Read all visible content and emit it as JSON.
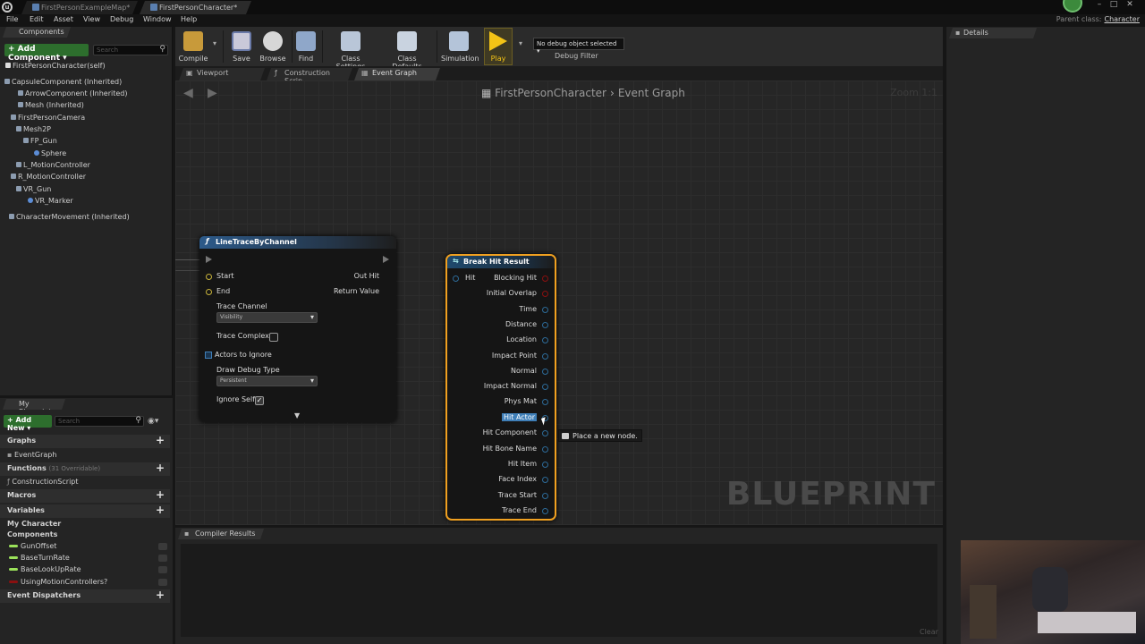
{
  "window": {
    "tabs": [
      "FirstPersonExampleMap*",
      "FirstPersonCharacter*"
    ],
    "parent_class_label": "Parent class:",
    "parent_class_value": "Character"
  },
  "menubar": [
    "File",
    "Edit",
    "Asset",
    "View",
    "Debug",
    "Window",
    "Help"
  ],
  "components": {
    "tab": "Components",
    "add_button": "+ Add Component ▾",
    "search_placeholder": "Search",
    "self": "FirstPersonCharacter(self)",
    "tree": [
      "CapsuleComponent (Inherited)",
      "ArrowComponent (Inherited)",
      "Mesh (Inherited)",
      "FirstPersonCamera",
      "Mesh2P",
      "FP_Gun",
      "Sphere",
      "L_MotionController",
      "R_MotionController",
      "VR_Gun",
      "VR_Marker",
      "CharacterMovement (Inherited)"
    ]
  },
  "my_blueprint": {
    "tab": "My Blueprint",
    "add_button": "+ Add New ▾",
    "search_placeholder": "Search",
    "graphs_label": "Graphs",
    "event_graph": "EventGraph",
    "functions_label": "Functions",
    "functions_count": "(31 Overridable)",
    "construction_script": "ConstructionScript",
    "macros_label": "Macros",
    "variables_label": "Variables",
    "my_character": "My Character",
    "components_label": "Components",
    "variables": [
      "GunOffset",
      "BaseTurnRate",
      "BaseLookUpRate",
      "UsingMotionControllers?"
    ],
    "event_dispatchers": "Event Dispatchers"
  },
  "toolbar": {
    "buttons": [
      "Compile",
      "Save",
      "Browse",
      "Find",
      "Class Settings",
      "Class Defaults",
      "Simulation",
      "Play"
    ],
    "debug_select": "No debug object selected ▾",
    "debug_filter": "Debug Filter"
  },
  "graph_tabs": [
    "Viewport",
    "Construction Scrip",
    "Event Graph"
  ],
  "graph": {
    "breadcrumb_root": "FirstPersonCharacter",
    "breadcrumb_leaf": "Event Graph",
    "zoom": "Zoom 1:1",
    "watermark": "BLUEPRINT"
  },
  "line_trace_node": {
    "title": "LineTraceByChannel",
    "start": "Start",
    "end": "End",
    "out_hit": "Out Hit",
    "return_value": "Return Value",
    "trace_channel": "Trace Channel",
    "trace_channel_value": "Visibility",
    "trace_complex": "Trace Complex",
    "actors_to_ignore": "Actors to Ignore",
    "draw_debug_type": "Draw Debug Type",
    "draw_debug_value": "Persistent",
    "ignore_self": "Ignore Self"
  },
  "break_hit_node": {
    "title": "Break Hit Result",
    "hit": "Hit",
    "pins": [
      "Blocking Hit",
      "Initial Overlap",
      "Time",
      "Distance",
      "Location",
      "Impact Point",
      "Normal",
      "Impact Normal",
      "Phys Mat",
      "Hit Actor",
      "Hit Component",
      "Hit Bone Name",
      "Hit Item",
      "Face Index",
      "Trace Start",
      "Trace End"
    ]
  },
  "tooltip": "Place a new node.",
  "details_tab": "Details",
  "compiler": {
    "tab": "Compiler Results",
    "clear": "Clear"
  },
  "colors": {
    "node_selected_border": "#f0a020",
    "function_header": "#2c5a8a",
    "struct_header": "#1f4a6e",
    "struct_pin": "#2d6b99",
    "bool_pin": "#8a1010",
    "green_button": "#2d6e2d"
  }
}
